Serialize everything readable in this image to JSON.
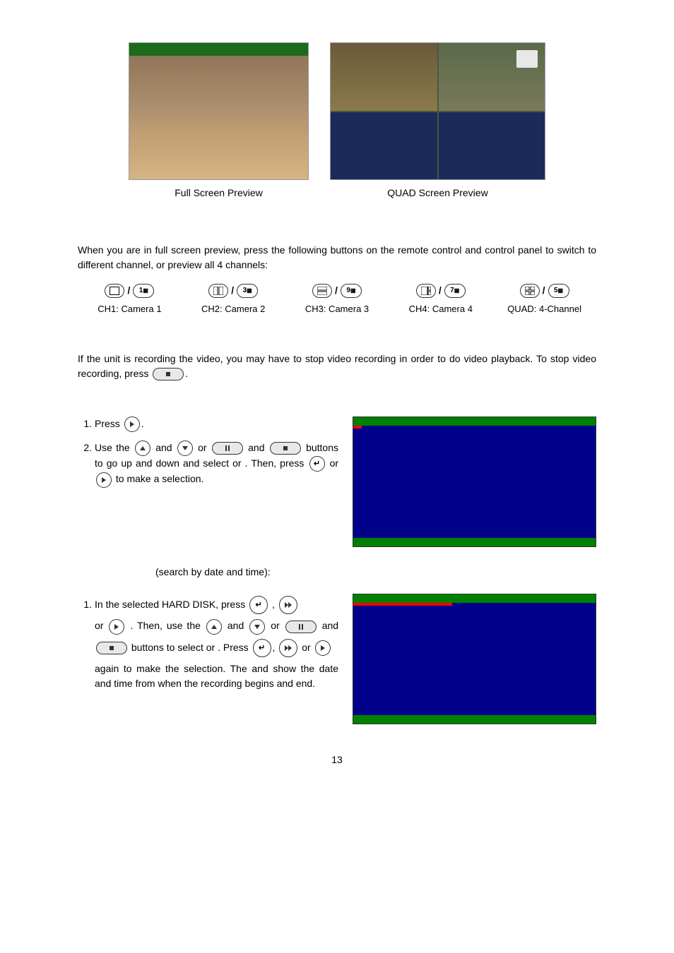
{
  "captions": {
    "full": "Full Screen Preview",
    "quad": "QUAD Screen Preview"
  },
  "paragraphs": {
    "p1": "When you are in full screen preview, press the following buttons on the remote control and control panel to switch to different channel, or preview all 4 channels:",
    "p2_a": "If the unit is recording the video, you may have to stop video recording in order to do video playback. To stop video recording, press",
    "p2_b": "."
  },
  "channels": {
    "ch1_num": "1",
    "ch1_label": "CH1: Camera 1",
    "ch2_num": "3",
    "ch2_label": "CH2: Camera 2",
    "ch3_num": "9",
    "ch3_label": "CH3: Camera 3",
    "ch4_num": "7",
    "ch4_label": "CH4: Camera 4",
    "quad_num": "5",
    "quad_label": "QUAD: 4-Channel"
  },
  "section1": {
    "step1_a": "Press",
    "step1_b": ".",
    "step2_a": "Use the ",
    "step2_b": " and ",
    "step2_c": " or ",
    "step2_d": " and ",
    "step2_e": " buttons to go up and down and select ",
    "step2_f": " or ",
    "step2_g": ". Then, press ",
    "step2_h": " or ",
    "step2_i": " to make a selection."
  },
  "section2": {
    "heading": "(search by date and time):",
    "step1_a": "In the selected HARD DISK, press ",
    "step1_b": " , ",
    "step1_c": " or ",
    "step1_d": ". Then, use the ",
    "step1_e": " and ",
    "step1_f": " or ",
    "step1_g": " and ",
    "step1_h": " buttons to select ",
    "step1_i": " or ",
    "step1_j": ". Press",
    "step1_k": ", ",
    "step1_l": "or ",
    "step1_m": " again to make the selection. The ",
    "step1_n": " and ",
    "step1_o": " show the date and time from when the recording begins and end."
  },
  "page_number": "13"
}
